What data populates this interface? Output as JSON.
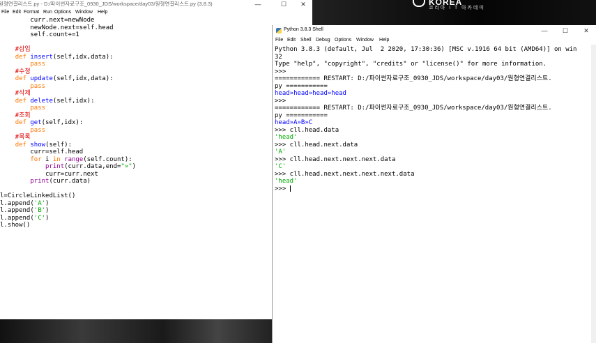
{
  "desktop": {
    "logo_text": "KOREA",
    "logo_sub": "코리아 I T 아카데미"
  },
  "editor": {
    "title": "원형연결리스트.py - D:/파이썬자료구조_0930_JDS/workspace/day03/원형연결리스트.py (3.8.3)",
    "window_controls": [
      "—",
      "☐",
      "✕"
    ],
    "menu": [
      "File",
      "Edit",
      "Format",
      "Run",
      "Options",
      "Window",
      "Help"
    ],
    "code_lines": [
      [
        {
          "t": "        curr.next=newNode",
          "c": ""
        }
      ],
      [
        {
          "t": "        newNode.next=self.head",
          "c": ""
        }
      ],
      [
        {
          "t": "        self.count+=1",
          "c": ""
        }
      ],
      [
        {
          "t": "",
          "c": ""
        }
      ],
      [
        {
          "t": "    #삽입",
          "c": "cm"
        }
      ],
      [
        {
          "t": "    ",
          "c": ""
        },
        {
          "t": "def",
          "c": "kw"
        },
        {
          "t": " ",
          "c": ""
        },
        {
          "t": "insert",
          "c": "def"
        },
        {
          "t": "(self,idx,data):",
          "c": ""
        }
      ],
      [
        {
          "t": "        ",
          "c": ""
        },
        {
          "t": "pass",
          "c": "kw"
        }
      ],
      [
        {
          "t": "    #수정",
          "c": "cm"
        }
      ],
      [
        {
          "t": "    ",
          "c": ""
        },
        {
          "t": "def",
          "c": "kw"
        },
        {
          "t": " ",
          "c": ""
        },
        {
          "t": "update",
          "c": "def"
        },
        {
          "t": "(self,idx,data):",
          "c": ""
        }
      ],
      [
        {
          "t": "        ",
          "c": ""
        },
        {
          "t": "pass",
          "c": "kw"
        }
      ],
      [
        {
          "t": "    #삭제",
          "c": "cm"
        }
      ],
      [
        {
          "t": "    ",
          "c": ""
        },
        {
          "t": "def",
          "c": "kw"
        },
        {
          "t": " ",
          "c": ""
        },
        {
          "t": "delete",
          "c": "def"
        },
        {
          "t": "(self,idx):",
          "c": ""
        }
      ],
      [
        {
          "t": "        ",
          "c": ""
        },
        {
          "t": "pass",
          "c": "kw"
        }
      ],
      [
        {
          "t": "    #조회",
          "c": "cm"
        }
      ],
      [
        {
          "t": "    ",
          "c": ""
        },
        {
          "t": "def",
          "c": "kw"
        },
        {
          "t": " ",
          "c": ""
        },
        {
          "t": "get",
          "c": "def"
        },
        {
          "t": "(self,idx):",
          "c": ""
        }
      ],
      [
        {
          "t": "        ",
          "c": ""
        },
        {
          "t": "pass",
          "c": "kw"
        }
      ],
      [
        {
          "t": "    #목록",
          "c": "cm"
        }
      ],
      [
        {
          "t": "    ",
          "c": ""
        },
        {
          "t": "def",
          "c": "kw"
        },
        {
          "t": " ",
          "c": ""
        },
        {
          "t": "show",
          "c": "def"
        },
        {
          "t": "(self):",
          "c": ""
        }
      ],
      [
        {
          "t": "        curr=self.head",
          "c": ""
        }
      ],
      [
        {
          "t": "        ",
          "c": ""
        },
        {
          "t": "for",
          "c": "kw"
        },
        {
          "t": " i ",
          "c": ""
        },
        {
          "t": "in",
          "c": "kw"
        },
        {
          "t": " ",
          "c": ""
        },
        {
          "t": "range",
          "c": "bi"
        },
        {
          "t": "(self.count):",
          "c": ""
        }
      ],
      [
        {
          "t": "            ",
          "c": ""
        },
        {
          "t": "print",
          "c": "bi"
        },
        {
          "t": "(curr.data,end=",
          "c": ""
        },
        {
          "t": "\"»\"",
          "c": "str"
        },
        {
          "t": ")",
          "c": ""
        }
      ],
      [
        {
          "t": "            curr=curr.next",
          "c": ""
        }
      ],
      [
        {
          "t": "        ",
          "c": ""
        },
        {
          "t": "print",
          "c": "bi"
        },
        {
          "t": "(curr.data)",
          "c": ""
        }
      ],
      [
        {
          "t": "",
          "c": ""
        }
      ],
      [
        {
          "t": "l=CircleLinkedList()",
          "c": ""
        }
      ],
      [
        {
          "t": "l.append(",
          "c": ""
        },
        {
          "t": "'A'",
          "c": "str"
        },
        {
          "t": ")",
          "c": ""
        }
      ],
      [
        {
          "t": "l.append(",
          "c": ""
        },
        {
          "t": "'B'",
          "c": "str"
        },
        {
          "t": ")",
          "c": ""
        }
      ],
      [
        {
          "t": "l.append(",
          "c": ""
        },
        {
          "t": "'C'",
          "c": "str"
        },
        {
          "t": ")",
          "c": ""
        }
      ],
      [
        {
          "t": "l.show()",
          "c": ""
        }
      ]
    ]
  },
  "shell": {
    "title": "Python 3.8.3 Shell",
    "window_controls": [
      "—",
      "☐",
      "✕"
    ],
    "menu": [
      "File",
      "Edit",
      "Shell",
      "Debug",
      "Options",
      "Window",
      "Help"
    ],
    "lines": [
      [
        {
          "t": "Python 3.8.3 (default, Jul  2 2020, 17:30:36) [MSC v.1916 64 bit (AMD64)] on win",
          "c": ""
        }
      ],
      [
        {
          "t": "32",
          "c": ""
        }
      ],
      [
        {
          "t": "Type \"help\", \"copyright\", \"credits\" or \"license()\" for more information.",
          "c": ""
        }
      ],
      [
        {
          "t": ">>> ",
          "c": ""
        }
      ],
      [
        {
          "t": "============ RESTART: D:/파이썬자료구조_0930_JDS/workspace/day03/원형연결리스트.",
          "c": ""
        }
      ],
      [
        {
          "t": "py ===========",
          "c": ""
        }
      ],
      [
        {
          "t": "head»head»head»head",
          "c": "so"
        }
      ],
      [
        {
          "t": ">>> ",
          "c": ""
        }
      ],
      [
        {
          "t": "============ RESTART: D:/파이썬자료구조_0930_JDS/workspace/day03/원형연결리스트.",
          "c": ""
        }
      ],
      [
        {
          "t": "py ===========",
          "c": ""
        }
      ],
      [
        {
          "t": "head»A»B»C",
          "c": "so"
        }
      ],
      [
        {
          "t": ">>> cll.head.data",
          "c": ""
        }
      ],
      [
        {
          "t": "'head'",
          "c": "sr"
        }
      ],
      [
        {
          "t": ">>> cll.head.next.data",
          "c": ""
        }
      ],
      [
        {
          "t": "'A'",
          "c": "sr"
        }
      ],
      [
        {
          "t": ">>> cll.head.next.next.next.data",
          "c": ""
        }
      ],
      [
        {
          "t": "'C'",
          "c": "sr"
        }
      ],
      [
        {
          "t": ">>> cll.head.next.next.next.next.data",
          "c": ""
        }
      ],
      [
        {
          "t": "'head'",
          "c": "sr"
        }
      ],
      [
        {
          "t": ">>> ",
          "c": ""
        }
      ]
    ]
  }
}
